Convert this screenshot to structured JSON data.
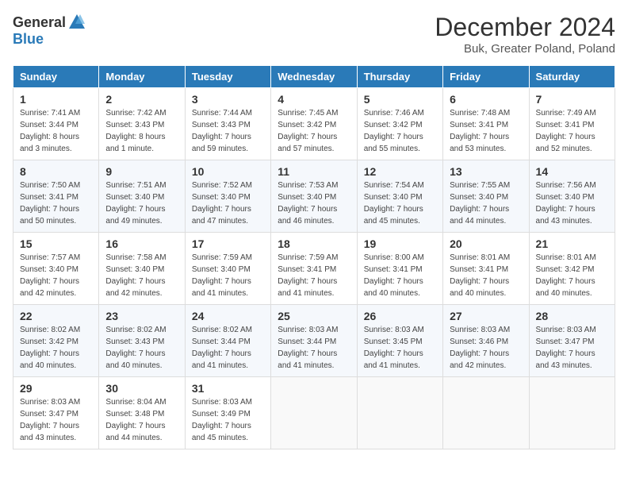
{
  "header": {
    "logo_general": "General",
    "logo_blue": "Blue",
    "month_year": "December 2024",
    "location": "Buk, Greater Poland, Poland"
  },
  "days_of_week": [
    "Sunday",
    "Monday",
    "Tuesday",
    "Wednesday",
    "Thursday",
    "Friday",
    "Saturday"
  ],
  "weeks": [
    [
      {
        "day": "1",
        "sunrise": "7:41 AM",
        "sunset": "3:44 PM",
        "daylight": "8 hours and 3 minutes."
      },
      {
        "day": "2",
        "sunrise": "7:42 AM",
        "sunset": "3:43 PM",
        "daylight": "8 hours and 1 minute."
      },
      {
        "day": "3",
        "sunrise": "7:44 AM",
        "sunset": "3:43 PM",
        "daylight": "7 hours and 59 minutes."
      },
      {
        "day": "4",
        "sunrise": "7:45 AM",
        "sunset": "3:42 PM",
        "daylight": "7 hours and 57 minutes."
      },
      {
        "day": "5",
        "sunrise": "7:46 AM",
        "sunset": "3:42 PM",
        "daylight": "7 hours and 55 minutes."
      },
      {
        "day": "6",
        "sunrise": "7:48 AM",
        "sunset": "3:41 PM",
        "daylight": "7 hours and 53 minutes."
      },
      {
        "day": "7",
        "sunrise": "7:49 AM",
        "sunset": "3:41 PM",
        "daylight": "7 hours and 52 minutes."
      }
    ],
    [
      {
        "day": "8",
        "sunrise": "7:50 AM",
        "sunset": "3:41 PM",
        "daylight": "7 hours and 50 minutes."
      },
      {
        "day": "9",
        "sunrise": "7:51 AM",
        "sunset": "3:40 PM",
        "daylight": "7 hours and 49 minutes."
      },
      {
        "day": "10",
        "sunrise": "7:52 AM",
        "sunset": "3:40 PM",
        "daylight": "7 hours and 47 minutes."
      },
      {
        "day": "11",
        "sunrise": "7:53 AM",
        "sunset": "3:40 PM",
        "daylight": "7 hours and 46 minutes."
      },
      {
        "day": "12",
        "sunrise": "7:54 AM",
        "sunset": "3:40 PM",
        "daylight": "7 hours and 45 minutes."
      },
      {
        "day": "13",
        "sunrise": "7:55 AM",
        "sunset": "3:40 PM",
        "daylight": "7 hours and 44 minutes."
      },
      {
        "day": "14",
        "sunrise": "7:56 AM",
        "sunset": "3:40 PM",
        "daylight": "7 hours and 43 minutes."
      }
    ],
    [
      {
        "day": "15",
        "sunrise": "7:57 AM",
        "sunset": "3:40 PM",
        "daylight": "7 hours and 42 minutes."
      },
      {
        "day": "16",
        "sunrise": "7:58 AM",
        "sunset": "3:40 PM",
        "daylight": "7 hours and 42 minutes."
      },
      {
        "day": "17",
        "sunrise": "7:59 AM",
        "sunset": "3:40 PM",
        "daylight": "7 hours and 41 minutes."
      },
      {
        "day": "18",
        "sunrise": "7:59 AM",
        "sunset": "3:41 PM",
        "daylight": "7 hours and 41 minutes."
      },
      {
        "day": "19",
        "sunrise": "8:00 AM",
        "sunset": "3:41 PM",
        "daylight": "7 hours and 40 minutes."
      },
      {
        "day": "20",
        "sunrise": "8:01 AM",
        "sunset": "3:41 PM",
        "daylight": "7 hours and 40 minutes."
      },
      {
        "day": "21",
        "sunrise": "8:01 AM",
        "sunset": "3:42 PM",
        "daylight": "7 hours and 40 minutes."
      }
    ],
    [
      {
        "day": "22",
        "sunrise": "8:02 AM",
        "sunset": "3:42 PM",
        "daylight": "7 hours and 40 minutes."
      },
      {
        "day": "23",
        "sunrise": "8:02 AM",
        "sunset": "3:43 PM",
        "daylight": "7 hours and 40 minutes."
      },
      {
        "day": "24",
        "sunrise": "8:02 AM",
        "sunset": "3:44 PM",
        "daylight": "7 hours and 41 minutes."
      },
      {
        "day": "25",
        "sunrise": "8:03 AM",
        "sunset": "3:44 PM",
        "daylight": "7 hours and 41 minutes."
      },
      {
        "day": "26",
        "sunrise": "8:03 AM",
        "sunset": "3:45 PM",
        "daylight": "7 hours and 41 minutes."
      },
      {
        "day": "27",
        "sunrise": "8:03 AM",
        "sunset": "3:46 PM",
        "daylight": "7 hours and 42 minutes."
      },
      {
        "day": "28",
        "sunrise": "8:03 AM",
        "sunset": "3:47 PM",
        "daylight": "7 hours and 43 minutes."
      }
    ],
    [
      {
        "day": "29",
        "sunrise": "8:03 AM",
        "sunset": "3:47 PM",
        "daylight": "7 hours and 43 minutes."
      },
      {
        "day": "30",
        "sunrise": "8:04 AM",
        "sunset": "3:48 PM",
        "daylight": "7 hours and 44 minutes."
      },
      {
        "day": "31",
        "sunrise": "8:03 AM",
        "sunset": "3:49 PM",
        "daylight": "7 hours and 45 minutes."
      },
      null,
      null,
      null,
      null
    ]
  ],
  "labels": {
    "sunrise": "Sunrise:",
    "sunset": "Sunset:",
    "daylight": "Daylight hours"
  }
}
